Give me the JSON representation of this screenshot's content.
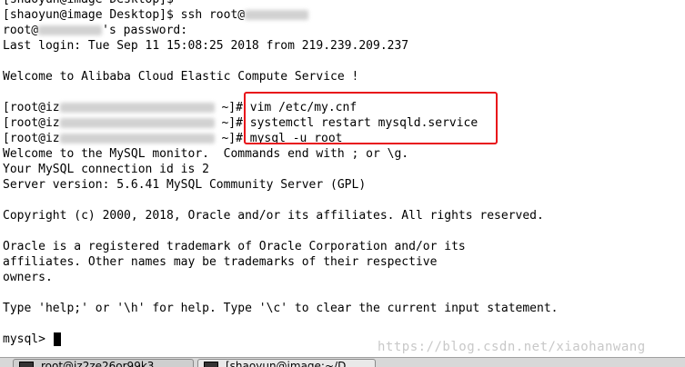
{
  "terminal": {
    "lines": [
      {
        "pre": "[shaoyun@image Desktop]$",
        "blur": false,
        "post": ""
      },
      {
        "pre": "[shaoyun@image Desktop]$ ssh root@",
        "blur": true,
        "post": ""
      },
      {
        "pre": "root@",
        "blur": true,
        "post": "'s password:"
      },
      {
        "pre": "Last login: Tue Sep 11 15:08:25 2018 from 219.239.209.237",
        "blur": false,
        "post": ""
      },
      {
        "pre": "",
        "blur": false,
        "post": ""
      },
      {
        "pre": "Welcome to Alibaba Cloud Elastic Compute Service !",
        "blur": false,
        "post": ""
      },
      {
        "pre": "",
        "blur": false,
        "post": ""
      },
      {
        "pre": "[root@iz",
        "blur": true,
        "post": " ~]# vim /etc/my.cnf"
      },
      {
        "pre": "[root@iz",
        "blur": true,
        "post": " ~]# systemctl restart mysqld.service"
      },
      {
        "pre": "[root@iz",
        "blur": true,
        "post": " ~]# mysql -u root"
      },
      {
        "pre": "Welcome to the MySQL monitor.  Commands end with ; or \\g.",
        "blur": false,
        "post": ""
      },
      {
        "pre": "Your MySQL connection id is 2",
        "blur": false,
        "post": ""
      },
      {
        "pre": "Server version: 5.6.41 MySQL Community Server (GPL)",
        "blur": false,
        "post": ""
      },
      {
        "pre": "",
        "blur": false,
        "post": ""
      },
      {
        "pre": "Copyright (c) 2000, 2018, Oracle and/or its affiliates. All rights reserved.",
        "blur": false,
        "post": ""
      },
      {
        "pre": "",
        "blur": false,
        "post": ""
      },
      {
        "pre": "Oracle is a registered trademark of Oracle Corporation and/or its",
        "blur": false,
        "post": ""
      },
      {
        "pre": "affiliates. Other names may be trademarks of their respective",
        "blur": false,
        "post": ""
      },
      {
        "pre": "owners.",
        "blur": false,
        "post": ""
      },
      {
        "pre": "",
        "blur": false,
        "post": ""
      },
      {
        "pre": "Type 'help;' or '\\h' for help. Type '\\c' to clear the current input statement.",
        "blur": false,
        "post": ""
      },
      {
        "pre": "",
        "blur": false,
        "post": ""
      },
      {
        "pre": "mysql> ",
        "blur": false,
        "post": ""
      }
    ]
  },
  "watermark": "https://blog.csdn.net/xiaohanwang",
  "taskbar": {
    "items": [
      {
        "label": "root@iz2ze26or99k3",
        "icon": "terminal-icon"
      },
      {
        "label": "[shaoyun@image:~/D",
        "icon": "terminal-icon"
      }
    ]
  },
  "colors": {
    "highlight": "#e8121a",
    "text": "#000000",
    "watermark": "#c8c8c8"
  }
}
